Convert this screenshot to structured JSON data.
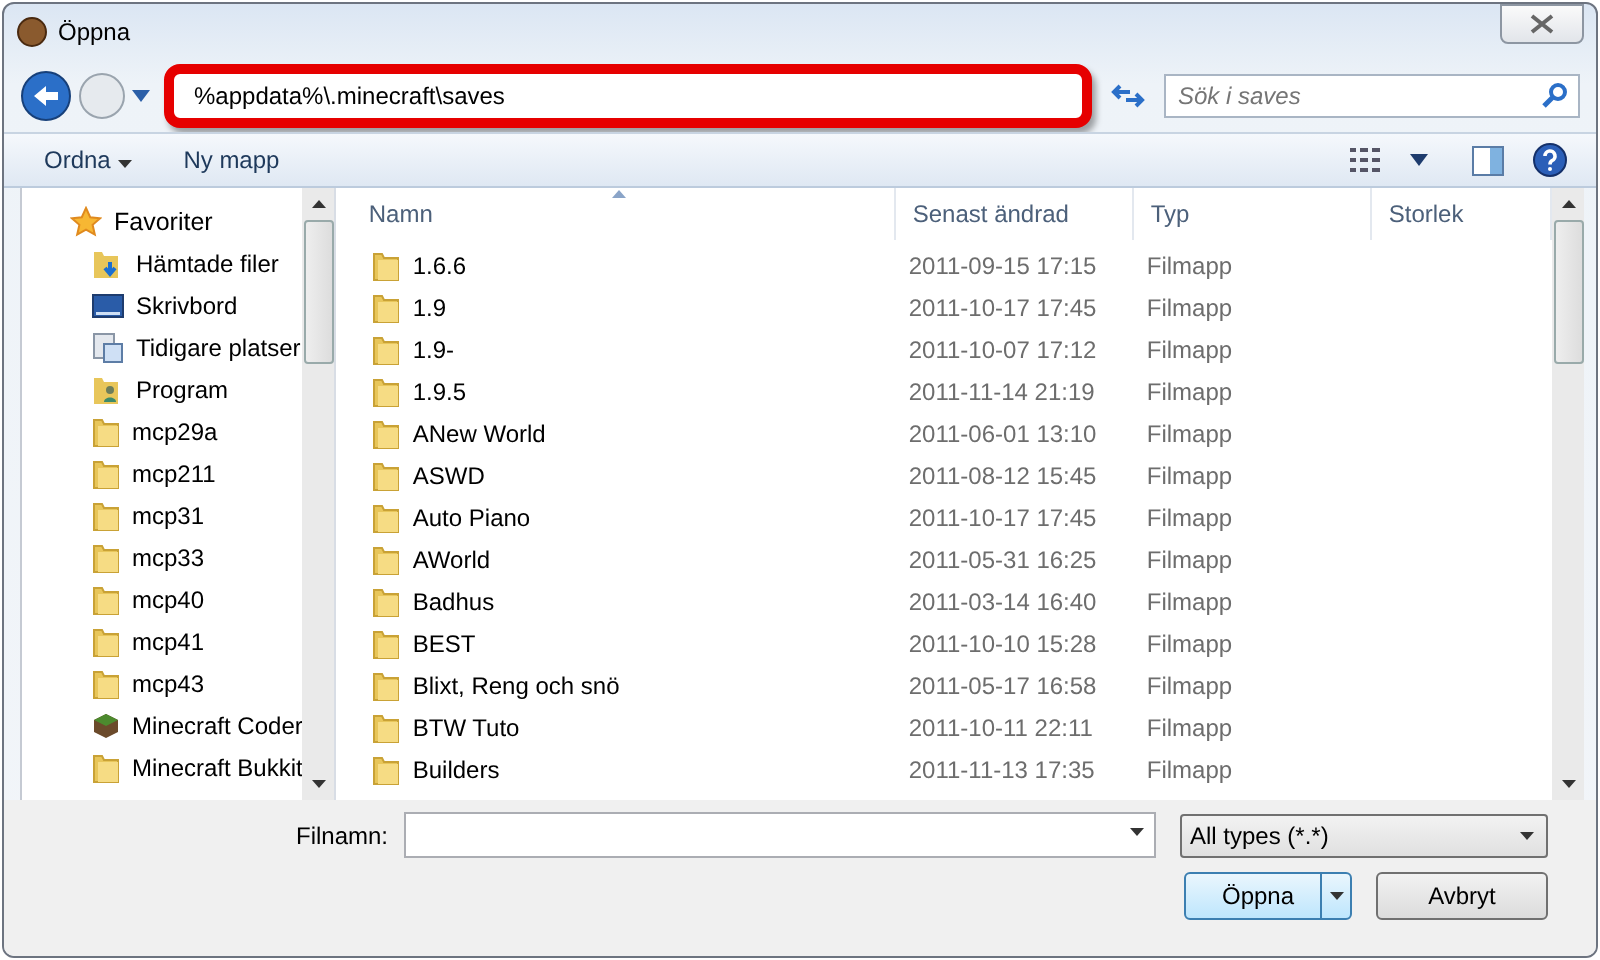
{
  "window": {
    "title": "Öppna"
  },
  "address": {
    "value": "%appdata%\\.minecraft\\saves"
  },
  "search": {
    "placeholder": "Sök i saves"
  },
  "toolbar": {
    "organize": "Ordna",
    "new_folder": "Ny mapp"
  },
  "sidebar": {
    "items": [
      {
        "label": "Favoriter",
        "kind": "star",
        "children": [
          {
            "label": "Hämtade filer",
            "kind": "download"
          },
          {
            "label": "Skrivbord",
            "kind": "desktop"
          },
          {
            "label": "Tidigare platser",
            "kind": "recent"
          },
          {
            "label": "Program",
            "kind": "program"
          },
          {
            "label": "mcp29a",
            "kind": "folder"
          },
          {
            "label": "mcp211",
            "kind": "folder"
          },
          {
            "label": "mcp31",
            "kind": "folder"
          },
          {
            "label": "mcp33",
            "kind": "folder"
          },
          {
            "label": "mcp40",
            "kind": "folder"
          },
          {
            "label": "mcp41",
            "kind": "folder"
          },
          {
            "label": "mcp43",
            "kind": "folder"
          },
          {
            "label": "Minecraft Coder",
            "kind": "block"
          },
          {
            "label": "Minecraft Bukkit",
            "kind": "folder"
          }
        ]
      }
    ]
  },
  "table": {
    "columns": [
      "Namn",
      "Senast ändrad",
      "Typ",
      "Storlek"
    ],
    "rows": [
      {
        "name": "1.6.6",
        "modified": "2011-09-15 17:15",
        "type": "Filmapp"
      },
      {
        "name": "1.9",
        "modified": "2011-10-17 17:45",
        "type": "Filmapp"
      },
      {
        "name": "1.9-",
        "modified": "2011-10-07 17:12",
        "type": "Filmapp"
      },
      {
        "name": "1.9.5",
        "modified": "2011-11-14 21:19",
        "type": "Filmapp"
      },
      {
        "name": "ANew World",
        "modified": "2011-06-01 13:10",
        "type": "Filmapp"
      },
      {
        "name": "ASWD",
        "modified": "2011-08-12 15:45",
        "type": "Filmapp"
      },
      {
        "name": "Auto Piano",
        "modified": "2011-10-17 17:45",
        "type": "Filmapp"
      },
      {
        "name": "AWorld",
        "modified": "2011-05-31 16:25",
        "type": "Filmapp"
      },
      {
        "name": "Badhus",
        "modified": "2011-03-14 16:40",
        "type": "Filmapp"
      },
      {
        "name": "BEST",
        "modified": "2011-10-10 15:28",
        "type": "Filmapp"
      },
      {
        "name": "Blixt, Reng och snö",
        "modified": "2011-05-17 16:58",
        "type": "Filmapp"
      },
      {
        "name": "BTW Tuto",
        "modified": "2011-10-11 22:11",
        "type": "Filmapp"
      },
      {
        "name": "Builders",
        "modified": "2011-11-13 17:35",
        "type": "Filmapp"
      }
    ]
  },
  "bottom": {
    "filename_label": "Filnamn:",
    "filter": "All types (*.*)",
    "open": "Öppna",
    "cancel": "Avbryt"
  }
}
